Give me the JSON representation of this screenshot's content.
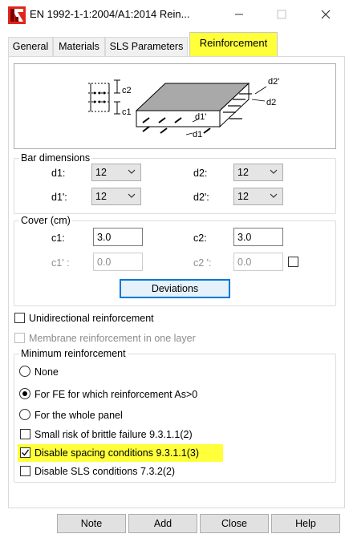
{
  "window": {
    "title": "EN 1992-1-1:2004/A1:2014 Rein...",
    "icon": "app-red-icon",
    "controls": [
      "minimize-icon",
      "maximize-icon",
      "close-icon"
    ]
  },
  "tabs": [
    {
      "label": "General",
      "active": false
    },
    {
      "label": "Materials",
      "active": false
    },
    {
      "label": "SLS Parameters",
      "active": false
    },
    {
      "label": "Reinforcement",
      "active": true
    }
  ],
  "diagram": {
    "labels": {
      "c2": "c2",
      "c1": "c1",
      "d2p": "d2'",
      "d2": "d2",
      "d1p": "d1'",
      "d1": "d1"
    }
  },
  "bar_dimensions": {
    "title": "Bar dimensions",
    "d1": {
      "label": "d1:",
      "value": "12"
    },
    "d2": {
      "label": "d2:",
      "value": "12"
    },
    "d1p": {
      "label": "d1':",
      "value": "12"
    },
    "d2p": {
      "label": "d2':",
      "value": "12"
    }
  },
  "cover": {
    "title": "Cover (cm)",
    "c1": {
      "label": "c1:",
      "value": "3.0"
    },
    "c2": {
      "label": "c2:",
      "value": "3.0"
    },
    "c1p": {
      "label": "c1' :",
      "value": "0.0"
    },
    "c2p": {
      "label": "c2 ':",
      "value": "0.0"
    },
    "deviations_label": "Deviations"
  },
  "options": {
    "unidirectional": {
      "label": "Unidirectional reinforcement",
      "checked": false
    },
    "membrane": {
      "label": "Membrane reinforcement in one layer",
      "checked": false,
      "disabled": true
    }
  },
  "minimum": {
    "title": "Minimum reinforcement",
    "radio_none": "None",
    "radio_fe": "For FE for which reinforcement As>0",
    "radio_panel": "For the whole panel",
    "selected": "For FE for which reinforcement As>0",
    "brittle": {
      "label": "Small risk of brittle failure  9.3.1.1(2)",
      "checked": false
    },
    "spacing": {
      "label": "Disable spacing conditions 9.3.1.1(3)",
      "checked": true
    },
    "sls": {
      "label": "Disable SLS conditions 7.3.2(2)",
      "checked": false
    }
  },
  "footer": {
    "note": "Note",
    "add": "Add",
    "close": "Close",
    "help": "Help"
  },
  "colors": {
    "highlight": "#ffff3a",
    "focus_border": "#0078d7",
    "app_icon": "#e1261c"
  }
}
